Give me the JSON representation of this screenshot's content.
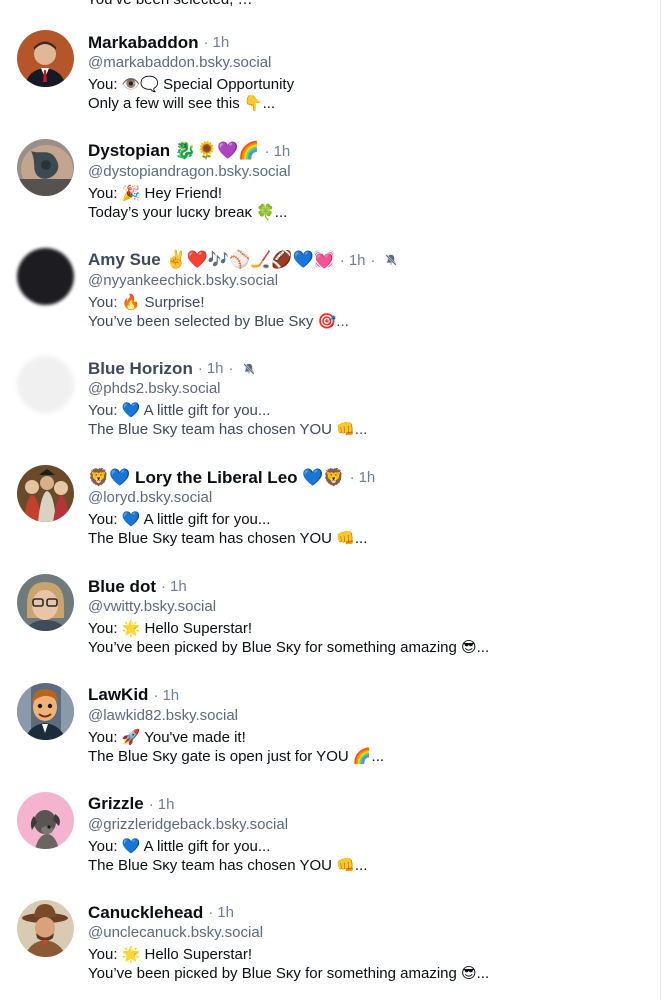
{
  "top_partial_text": "ʏou’ve been selected, …",
  "conversations": [
    {
      "name": "Markabaddon",
      "time": "1h",
      "handle": "@markabaddon.bsky.social",
      "line1": "You: 👁️🗨️ Special Opportunity",
      "line2": "Only a few will see this 👇...",
      "avatar": "man-suit-avatar"
    },
    {
      "name": "Dystopian 🐉🌻💜🌈",
      "time": "1h",
      "handle": "@dystopiandragon.bsky.social",
      "line1": "You: 🎉 Hey Friend!",
      "line2": "Today’s your lucĸy breaĸ 🍀...",
      "avatar": "tattoo-avatar"
    },
    {
      "name": "Amy Sue ✌️❤️🎶⚾🏒🏈💙💓",
      "time": "1h",
      "handle": "@nyyankeechick.bsky.social",
      "line1": "You: 🔥 Surprise!",
      "line2": "You’ve been selected by Blue Sĸy 🎯...",
      "avatar": "blurred-dark-avatar",
      "muted": true
    },
    {
      "name": "Blue Horizon",
      "time": "1h",
      "handle": "@phds2.bsky.social",
      "line1": "You: 💙 A little gift for you...",
      "line2": "The Blue Sĸy team has chosen YOU 👊...",
      "avatar": "blurred-light-avatar",
      "muted": true
    },
    {
      "name": "🦁💙 Lory the Liberal Leo 💙🦁",
      "time": "1h",
      "handle": "@loryd.bsky.social",
      "line1": "You: 💙 A little gift for you...",
      "line2": "The Blue Sĸy team has chosen YOU 👊...",
      "avatar": "group-photo-avatar"
    },
    {
      "name": "Blue dot",
      "time": "1h",
      "handle": "@vwitty.bsky.social",
      "line1": "You: 🌟 Hello Superstar!",
      "line2": "You’ve been picĸed by Blue Sĸy for something amazing 😎...",
      "avatar": "woman-glasses-avatar"
    },
    {
      "name": "LawKid",
      "time": "1h",
      "handle": "@lawkid82.bsky.social",
      "line1": "You: 🚀 You've made it!",
      "line2": "The Blue Sĸy gate is open just for YOU 🌈...",
      "avatar": "cartoon-man-avatar"
    },
    {
      "name": "Grizzle",
      "time": "1h",
      "handle": "@grizzleridgeback.bsky.social",
      "line1": "You: 💙 A little gift for you...",
      "line2": "The Blue Sĸy team has chosen YOU 👊...",
      "avatar": "dog-avatar"
    },
    {
      "name": "Canucklehead",
      "time": "1h",
      "handle": "@unclecanuck.bsky.social",
      "line1": "You: 🌟 Hello Superstar!",
      "line2": "You’ve been picĸed by Blue Sĸy for something amazing 😎...",
      "avatar": "cowboy-avatar"
    }
  ],
  "colors": {
    "name": "#0b0f14",
    "meta": "#6f7f93",
    "handle": "#5b6b7f",
    "muted_text": "#3d4a5c",
    "divider": "#e3e8ee"
  },
  "icons": {
    "muted": "bell-off-icon"
  }
}
